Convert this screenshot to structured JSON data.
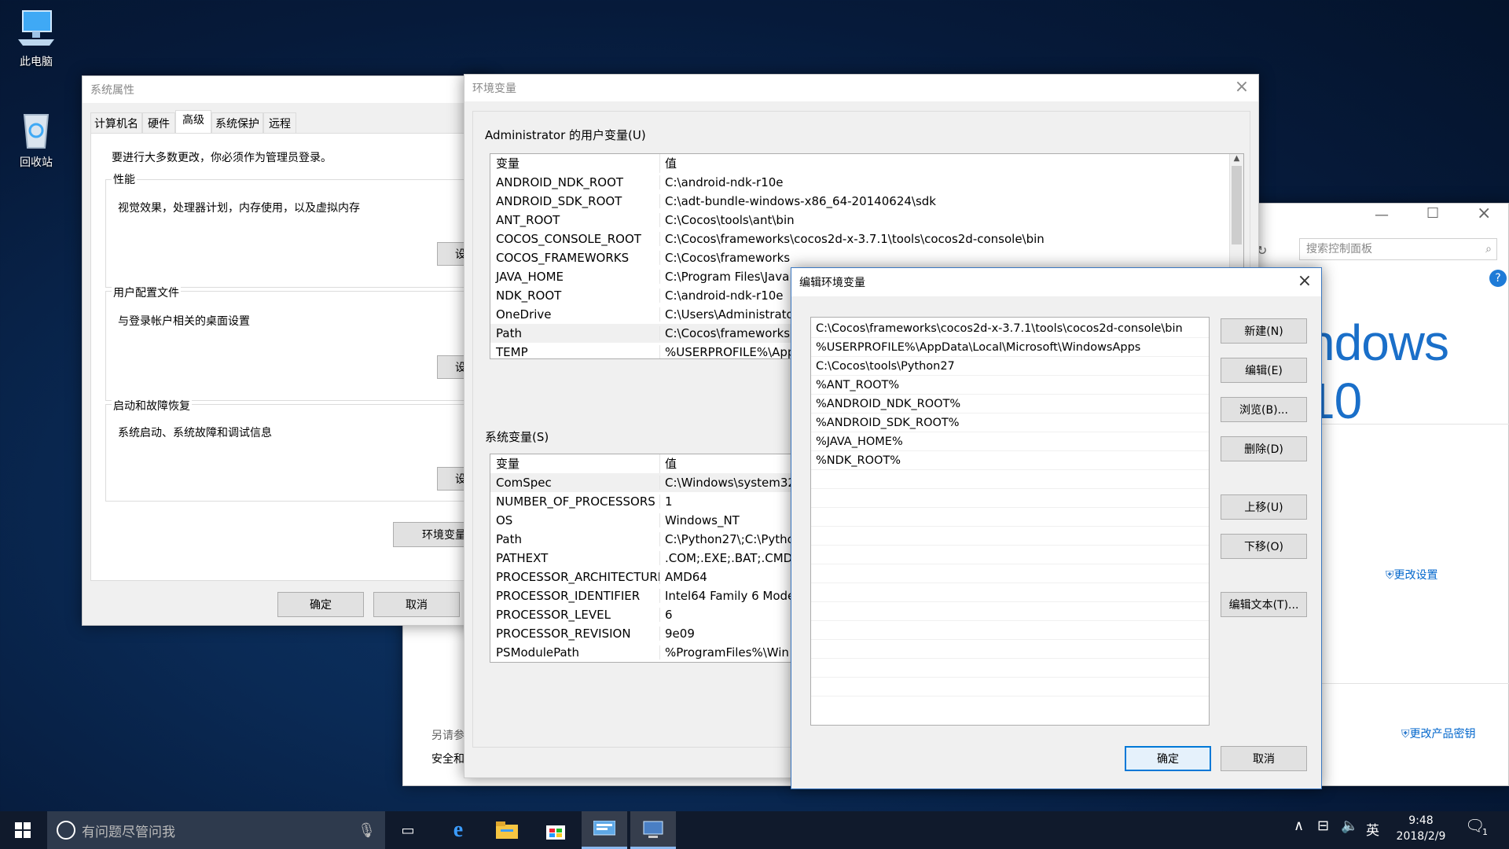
{
  "desktop": {
    "icons": [
      {
        "label": "此电脑",
        "icon": "computer-icon"
      },
      {
        "label": "回收站",
        "icon": "recycle-bin-icon"
      }
    ]
  },
  "sysprops": {
    "title": "系统属性",
    "tabs": [
      "计算机名",
      "硬件",
      "高级",
      "系统保护",
      "远程"
    ],
    "active_tab": "高级",
    "admin_note": "要进行大多数更改，你必须作为管理员登录。",
    "performance": {
      "label": "性能",
      "desc": "视觉效果，处理器计划，内存使用，以及虚拟内存",
      "button": "设"
    },
    "profile": {
      "label": "用户配置文件",
      "desc": "与登录帐户相关的桌面设置",
      "button": "设"
    },
    "startup": {
      "label": "启动和故障恢复",
      "desc": "系统启动、系统故障和调试信息",
      "button": "设"
    },
    "env_button": "环境变量",
    "ok": "确定",
    "cancel": "取消"
  },
  "control_panel": {
    "search_placeholder": "搜索控制面板",
    "windows_text": "ndows 10",
    "change_settings": "更改设置",
    "change_key": "更改产品密钥",
    "see_also": "另请参",
    "security": "安全和"
  },
  "envvars": {
    "title": "环境变量",
    "user_section": "Administrator 的用户变量(U)",
    "system_section": "系统变量(S)",
    "col_var": "变量",
    "col_val": "值",
    "user_vars": [
      {
        "name": "ANDROID_NDK_ROOT",
        "value": "C:\\android-ndk-r10e"
      },
      {
        "name": "ANDROID_SDK_ROOT",
        "value": "C:\\adt-bundle-windows-x86_64-20140624\\sdk"
      },
      {
        "name": "ANT_ROOT",
        "value": "C:\\Cocos\\tools\\ant\\bin"
      },
      {
        "name": "COCOS_CONSOLE_ROOT",
        "value": "C:\\Cocos\\frameworks\\cocos2d-x-3.7.1\\tools\\cocos2d-console\\bin"
      },
      {
        "name": "COCOS_FRAMEWORKS",
        "value": "C:\\Cocos\\frameworks"
      },
      {
        "name": "JAVA_HOME",
        "value": "C:\\Program Files\\Java"
      },
      {
        "name": "NDK_ROOT",
        "value": "C:\\android-ndk-r10e"
      },
      {
        "name": "OneDrive",
        "value": "C:\\Users\\Administrato"
      },
      {
        "name": "Path",
        "value": "C:\\Cocos\\frameworks"
      },
      {
        "name": "TEMP",
        "value": "%USERPROFILE%\\App"
      }
    ],
    "system_vars": [
      {
        "name": "ComSpec",
        "value": "C:\\Windows\\system32"
      },
      {
        "name": "NUMBER_OF_PROCESSORS",
        "value": "1"
      },
      {
        "name": "OS",
        "value": "Windows_NT"
      },
      {
        "name": "Path",
        "value": "C:\\Python27\\;C:\\Pytho"
      },
      {
        "name": "PATHEXT",
        "value": ".COM;.EXE;.BAT;.CMD"
      },
      {
        "name": "PROCESSOR_ARCHITECTURE",
        "value": "AMD64"
      },
      {
        "name": "PROCESSOR_IDENTIFIER",
        "value": "Intel64 Family 6 Mode"
      },
      {
        "name": "PROCESSOR_LEVEL",
        "value": "6"
      },
      {
        "name": "PROCESSOR_REVISION",
        "value": "9e09"
      },
      {
        "name": "PSModulePath",
        "value": "%ProgramFiles%\\Win"
      }
    ]
  },
  "editvar": {
    "title": "编辑环境变量",
    "entries": [
      "C:\\Cocos\\frameworks\\cocos2d-x-3.7.1\\tools\\cocos2d-console\\bin",
      "%USERPROFILE%\\AppData\\Local\\Microsoft\\WindowsApps",
      "C:\\Cocos\\tools\\Python27",
      "%ANT_ROOT%",
      "%ANDROID_NDK_ROOT%",
      "%ANDROID_SDK_ROOT%",
      "%JAVA_HOME%",
      "%NDK_ROOT%"
    ],
    "buttons": {
      "new": "新建(N)",
      "edit": "编辑(E)",
      "browse": "浏览(B)...",
      "delete": "删除(D)",
      "up": "上移(U)",
      "down": "下移(O)",
      "edit_text": "编辑文本(T)...",
      "ok": "确定",
      "cancel": "取消"
    }
  },
  "taskbar": {
    "search_placeholder": "有问题尽管问我",
    "ime": "英",
    "time": "9:48",
    "date": "2018/2/9",
    "notification_count": "1"
  }
}
